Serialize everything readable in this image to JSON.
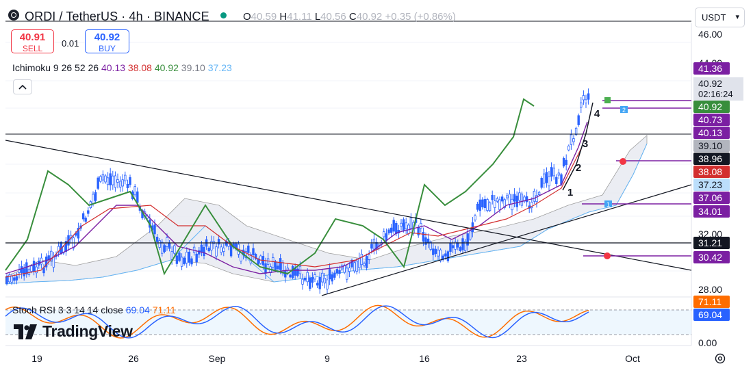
{
  "header": {
    "title": "ORDI / TetherUS · 4h · BINANCE",
    "ohlc": [
      {
        "k": "O",
        "v": "40.59"
      },
      {
        "k": "H",
        "v": "41.11"
      },
      {
        "k": "L",
        "v": "40.56"
      },
      {
        "k": "C",
        "v": "40.92"
      },
      {
        "k": "",
        "v": "+0.35 (+0.86%)"
      }
    ]
  },
  "trade": {
    "sell_price": "40.91",
    "sell_label": "SELL",
    "buy_price": "40.92",
    "buy_label": "BUY",
    "spread": "0.01"
  },
  "indicators": {
    "ichimoku_label": "Ichimoku 9 26 52 26",
    "ichimoku_values": [
      {
        "v": "40.13",
        "color": "#7b1fa2"
      },
      {
        "v": "38.08",
        "color": "#d32f2f"
      },
      {
        "v": "40.92",
        "color": "#388e3c"
      },
      {
        "v": "39.10",
        "color": "#787b86"
      },
      {
        "v": "37.23",
        "color": "#64b5f6"
      }
    ],
    "stoch_label": "Stoch RSI 3 3 14 14 close",
    "stoch_values": [
      {
        "v": "69.04",
        "color": "#2962ff"
      },
      {
        "v": "71.11",
        "color": "#ff6d00"
      }
    ]
  },
  "currency": "USDT",
  "collapse_icon": "chevron-up-icon",
  "brand": "TradingView",
  "colors": {
    "candle_up": "#2962ff",
    "candle_down": "#2962ff",
    "tenkan": "#7b1fa2",
    "kijun": "#d32f2f",
    "chikou": "#388e3c",
    "cloud": "#d1d4dc",
    "stoch_k": "#2962ff",
    "stoch_d": "#ff6d00"
  },
  "chart_data": {
    "type": "candlestick",
    "x_ticks": [
      "19",
      "26",
      "Sep",
      "9",
      "16",
      "23",
      "Oct"
    ],
    "y_ticks": [
      "46.00",
      "44.00",
      "32.00",
      "28.00"
    ],
    "stoch_ticks": [
      "0.00"
    ],
    "ylim": [
      27.5,
      46.2
    ],
    "price_tags": [
      {
        "v": "41.36",
        "bg": "#7b1fa2",
        "fg": "#ffffff"
      },
      {
        "v": "40.92",
        "bg": "#e0e3eb",
        "fg": "#131722",
        "countdown": "02:16:24"
      },
      {
        "v": "40.92",
        "bg": "#388e3c",
        "fg": "#ffffff"
      },
      {
        "v": "40.73",
        "bg": "#7b1fa2",
        "fg": "#ffffff"
      },
      {
        "v": "40.13",
        "bg": "#7b1fa2",
        "fg": "#ffffff"
      },
      {
        "v": "39.10",
        "bg": "#b2b5be",
        "fg": "#131722"
      },
      {
        "v": "38.96",
        "bg": "#131722",
        "fg": "#ffffff"
      },
      {
        "v": "38.08",
        "bg": "#d32f2f",
        "fg": "#ffffff"
      },
      {
        "v": "37.23",
        "bg": "#bbdefb",
        "fg": "#131722"
      },
      {
        "v": "37.06",
        "bg": "#7b1fa2",
        "fg": "#ffffff"
      },
      {
        "v": "34.01",
        "bg": "#7b1fa2",
        "fg": "#ffffff"
      },
      {
        "v": "31.21",
        "bg": "#131722",
        "fg": "#ffffff"
      },
      {
        "v": "30.42",
        "bg": "#7b1fa2",
        "fg": "#ffffff"
      }
    ],
    "stoch_tags": [
      {
        "v": "71.11",
        "bg": "#ff6d00",
        "fg": "#ffffff"
      },
      {
        "v": "69.04",
        "bg": "#2962ff",
        "fg": "#ffffff"
      }
    ],
    "wave_labels": [
      "1",
      "2",
      "3",
      "4"
    ],
    "alert_markers": [
      "1",
      "2"
    ]
  }
}
